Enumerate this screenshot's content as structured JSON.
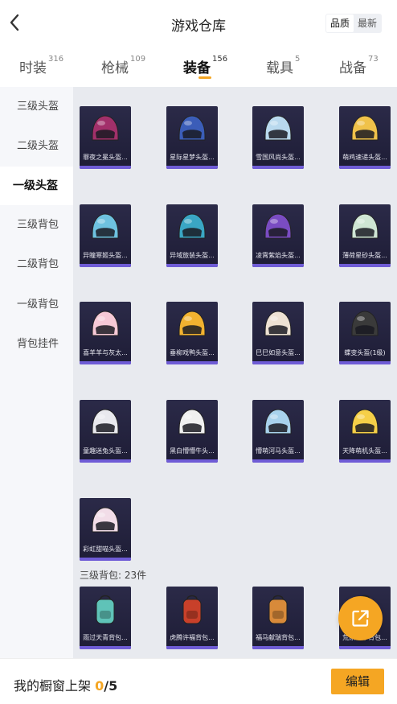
{
  "header": {
    "title": "游戏仓库",
    "sort_quality": "品质",
    "sort_latest": "最新"
  },
  "tabs": [
    {
      "label": "时装",
      "count": "316"
    },
    {
      "label": "枪械",
      "count": "109"
    },
    {
      "label": "装备",
      "count": "156"
    },
    {
      "label": "载具",
      "count": "5"
    },
    {
      "label": "战备",
      "count": "73"
    }
  ],
  "sidebar": [
    "三级头盔",
    "二级头盔",
    "一级头盔",
    "三级背包",
    "二级背包",
    "一级背包",
    "背包挂件"
  ],
  "helmets": [
    {
      "name": "罪夜之冕头盔...",
      "color": "#a2306a"
    },
    {
      "name": "星际星梦头盔...",
      "color": "#3b5db8"
    },
    {
      "name": "雪国风尚头盔...",
      "color": "#b9d9ee"
    },
    {
      "name": "萌鸡速递头盔...",
      "color": "#f0c24a"
    },
    {
      "name": "异瞳寒姬头盔...",
      "color": "#6ec2e0"
    },
    {
      "name": "异域旅装头盔...",
      "color": "#3aa6c4"
    },
    {
      "name": "凌霄紫焰头盔...",
      "color": "#7a4cc2"
    },
    {
      "name": "薄荷星砂头盔...",
      "color": "#cfe6d4"
    },
    {
      "name": "喜羊羊与灰太...",
      "color": "#f6c9d6"
    },
    {
      "name": "垂柳戏鸭头盔...",
      "color": "#f2b230"
    },
    {
      "name": "巳巳如意头盔...",
      "color": "#eee2d4"
    },
    {
      "name": "蝶变头盔(1级)",
      "color": "#3a3a3a"
    },
    {
      "name": "童趣迷兔头盔...",
      "color": "#e9e9ee"
    },
    {
      "name": "黑白懵懵牛头...",
      "color": "#f0f0f0"
    },
    {
      "name": "懵萌河马头盔...",
      "color": "#a8d2ec"
    },
    {
      "name": "天降萌机头盔...",
      "color": "#f5cf48"
    },
    {
      "name": "彩虹甜喵头盔...",
      "color": "#f2dde8"
    }
  ],
  "backpack_section": "三级背包: 23件",
  "backpacks": [
    {
      "name": "雨过天青背包...",
      "color": "#5fc3b8"
    },
    {
      "name": "虎腾许福背包...",
      "color": "#c8402a"
    },
    {
      "name": "福马献瑞背包...",
      "color": "#d88a3a"
    },
    {
      "name": "荒原铠甲背包...",
      "color": "#5a5f6a"
    }
  ],
  "footer": {
    "text": "我的橱窗上架",
    "count": "0",
    "total": "/5",
    "edit": "编辑"
  },
  "colors": {
    "accent": "#f5a623",
    "card_bg": "#2b2a48",
    "card_bar": "#6f5cd6"
  }
}
